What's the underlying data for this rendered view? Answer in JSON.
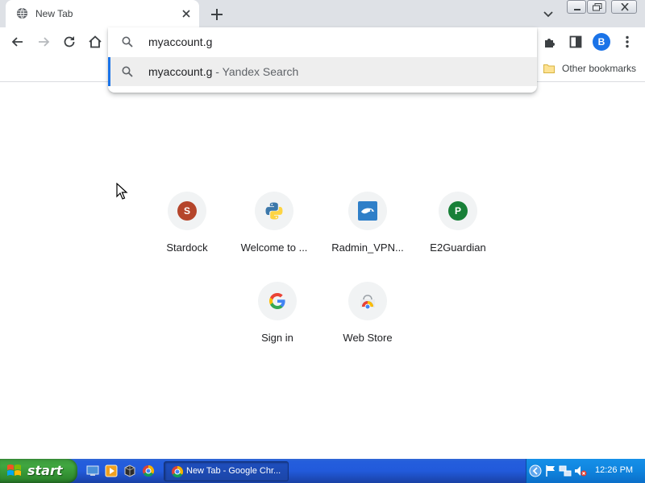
{
  "browser": {
    "tab": {
      "title": "New Tab"
    },
    "omnibox": {
      "value": "myaccount.g",
      "suggestion": {
        "query": "myaccount.g",
        "separator": " - ",
        "source": "Yandex Search"
      }
    },
    "profile_initial": "B",
    "bookmarks_bar": {
      "other_bookmarks_label": "Other bookmarks"
    }
  },
  "new_tab_page": {
    "shortcuts": [
      {
        "label": "Stardock",
        "icon": "letter-s",
        "letter": "S",
        "color": "#b5452b"
      },
      {
        "label": "Welcome to ...",
        "icon": "python-icon"
      },
      {
        "label": "Radmin_VPN...",
        "icon": "radmin-vpn-icon"
      },
      {
        "label": "E2Guardian",
        "icon": "letter-p",
        "letter": "P",
        "color": "#188038"
      },
      {
        "label": "Sign in",
        "icon": "google-icon"
      },
      {
        "label": "Web Store",
        "icon": "web-store-icon"
      }
    ]
  },
  "taskbar": {
    "start_label": "start",
    "task_button_label": "New Tab - Google Chr...",
    "clock": "12:26 PM"
  },
  "colors": {
    "accent": "#1a73e8",
    "tabstrip": "#dee1e6",
    "taskbar_blue": "#245edc",
    "start_green": "#3c9a3c"
  }
}
